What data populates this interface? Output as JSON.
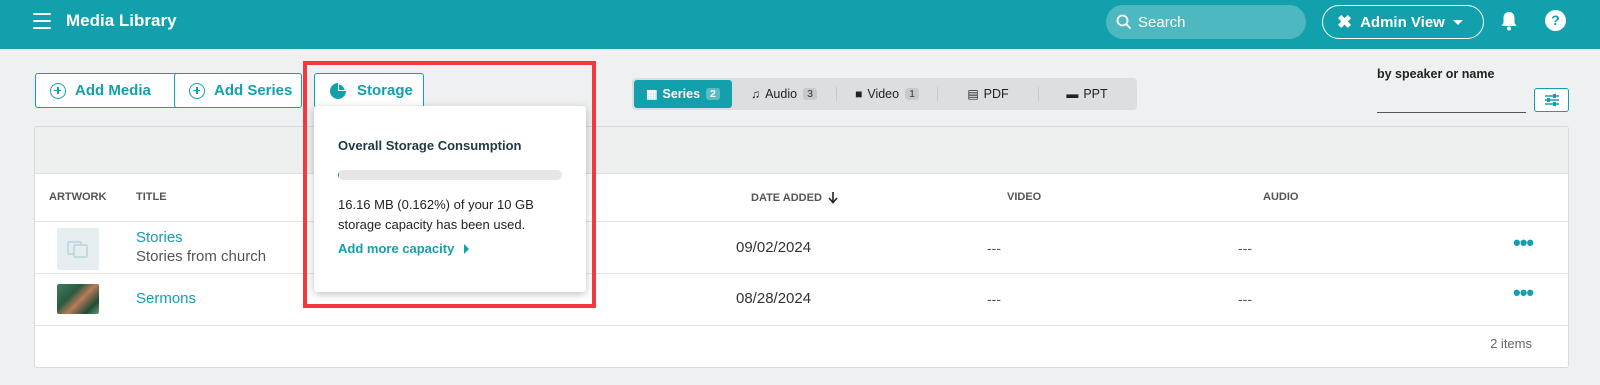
{
  "header": {
    "title": "Media Library",
    "search_placeholder": "Search",
    "admin_view_label": "Admin View",
    "help_label": "?"
  },
  "toolbar": {
    "add_media_label": "Add Media",
    "add_series_label": "Add Series",
    "storage_label": "Storage"
  },
  "tabs": [
    {
      "label": "Series",
      "count": "2",
      "active": true
    },
    {
      "label": "Audio",
      "count": "3"
    },
    {
      "label": "Video",
      "count": "1"
    },
    {
      "label": "PDF"
    },
    {
      "label": "PPT"
    }
  ],
  "filter": {
    "label": "by speaker or name",
    "value": ""
  },
  "table": {
    "columns": [
      "ARTWORK",
      "TITLE",
      "DATE ADDED",
      "VIDEO",
      "AUDIO"
    ],
    "rows": [
      {
        "title": "Stories",
        "subtitle": "Stories from church",
        "date_added": "09/02/2024",
        "video": "---",
        "audio": "---"
      },
      {
        "title": "Sermons",
        "subtitle": "",
        "date_added": "08/28/2024",
        "video": "---",
        "audio": "---"
      }
    ],
    "items_count": "2 items"
  },
  "storage_popover": {
    "title": "Overall Storage Consumption",
    "used_fraction": 0.00162,
    "text": "16.16 MB (0.162%) of your 10 GB storage capacity has been used.",
    "link_label": "Add more capacity"
  },
  "colors": {
    "brand": "#13a0ad",
    "highlight": "#f2393f"
  }
}
